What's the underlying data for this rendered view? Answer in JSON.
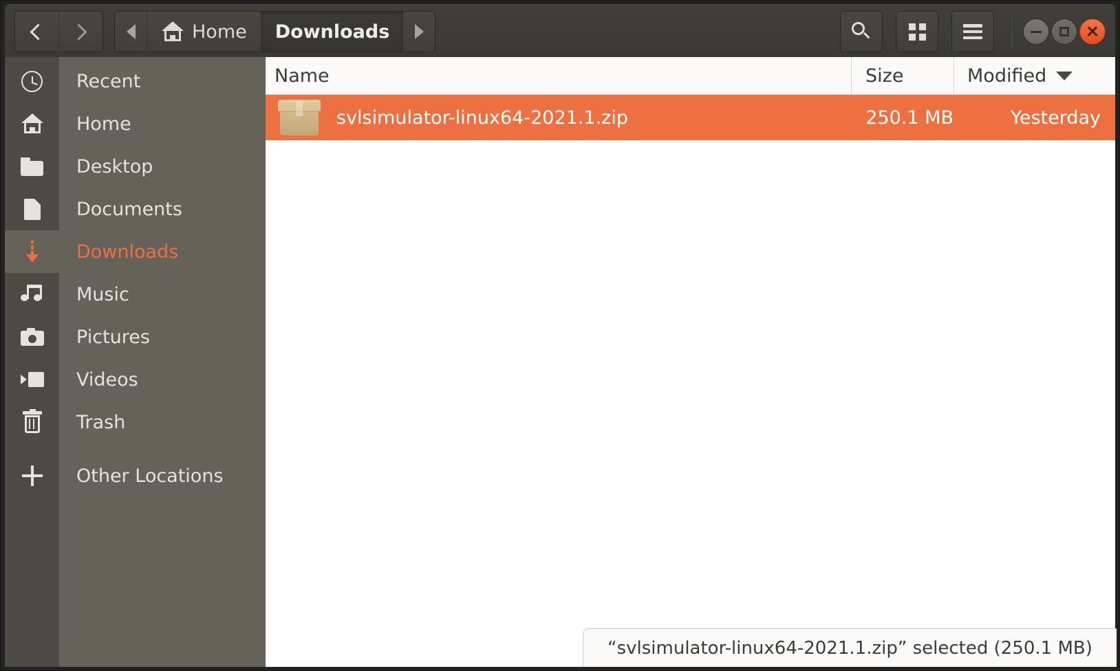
{
  "window": {
    "title": "Downloads",
    "controls": {
      "minimize_icon": "minimize-icon",
      "maximize_icon": "maximize-icon",
      "close_icon": "close-icon"
    }
  },
  "header": {
    "back_label": "‹",
    "forward_label": "›",
    "crumb_scroll_left_icon": "triangle-left-icon",
    "crumb_scroll_right_icon": "triangle-right-icon",
    "breadcrumbs": [
      {
        "label": "Home",
        "icon": "home-icon",
        "active": false
      },
      {
        "label": "Downloads",
        "icon": "",
        "active": true
      }
    ],
    "tools": {
      "search_icon": "search-icon",
      "view_grid_icon": "grid-view-icon",
      "menu_icon": "hamburger-menu-icon"
    }
  },
  "sidebar": {
    "items": [
      {
        "label": "Recent",
        "icon": "clock-icon",
        "selected": false
      },
      {
        "label": "Home",
        "icon": "home-icon",
        "selected": false
      },
      {
        "label": "Desktop",
        "icon": "folder-icon",
        "selected": false
      },
      {
        "label": "Documents",
        "icon": "document-icon",
        "selected": false
      },
      {
        "label": "Downloads",
        "icon": "download-icon",
        "selected": true
      },
      {
        "label": "Music",
        "icon": "music-icon",
        "selected": false
      },
      {
        "label": "Pictures",
        "icon": "camera-icon",
        "selected": false
      },
      {
        "label": "Videos",
        "icon": "video-icon",
        "selected": false
      },
      {
        "label": "Trash",
        "icon": "trash-icon",
        "selected": false
      },
      {
        "label": "Other Locations",
        "icon": "plus-icon",
        "selected": false
      }
    ]
  },
  "filelist": {
    "columns": {
      "name": "Name",
      "size": "Size",
      "modified": "Modified"
    },
    "sort_column": "Modified",
    "sort_caret_icon": "caret-down-icon",
    "rows": [
      {
        "name": "svlsimulator-linux64-2021.1.zip",
        "size": "250.1 MB",
        "modified": "Yesterday",
        "icon": "archive-box-icon",
        "selected": true
      }
    ]
  },
  "status": {
    "text": "“svlsimulator-linux64-2021.1.zip” selected  (250.1 MB)"
  },
  "colors": {
    "accent": "#ED7040",
    "header_bar": "#3C3B37",
    "sidebar_bg": "#656259",
    "sidebar_icon_col": "#4C4A42",
    "close_button": "#E24F1B"
  }
}
